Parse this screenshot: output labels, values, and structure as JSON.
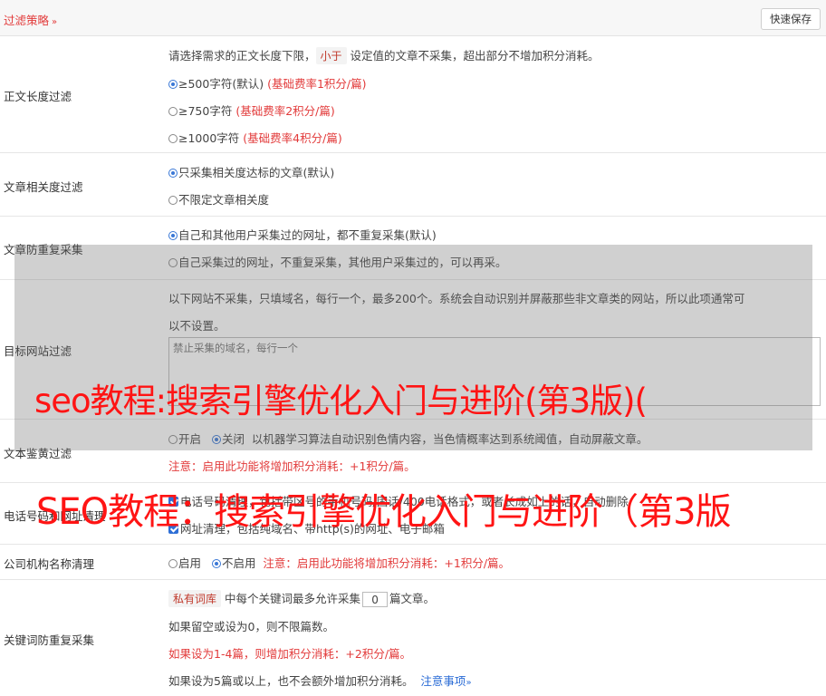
{
  "header": {
    "title": "过滤策略",
    "chevron": "»",
    "save_label": "快速保存"
  },
  "length_filter": {
    "label": "正文长度过滤",
    "desc_pre": "请选择需求的正文长度下限，",
    "desc_tag": "小于",
    "desc_post": "设定值的文章不采集，超出部分不增加积分消耗。",
    "options": [
      {
        "text": "≥500字符(默认)",
        "note": "(基础费率1积分/篇)"
      },
      {
        "text": "≥750字符",
        "note": "(基础费率2积分/篇)"
      },
      {
        "text": "≥1000字符",
        "note": "(基础费率4积分/篇)"
      }
    ]
  },
  "relevance": {
    "label": "文章相关度过滤",
    "options": [
      "只采集相关度达标的文章(默认)",
      "不限定文章相关度"
    ]
  },
  "dedupe": {
    "label": "文章防重复采集",
    "options": [
      "自己和其他用户采集过的网址，都不重复采集(默认)",
      "自己采集过的网址，不重复采集，其他用户采集过的，可以再采。"
    ]
  },
  "site_filter": {
    "label": "目标网站过滤",
    "desc_1": "以下网站不采集，只填域名，每行一个，最多200个。系统会自动识别并屏蔽那些非文章类的网站，所以此项通常可",
    "desc_2": "以不设置。",
    "placeholder": "禁止采集的域名，每行一个"
  },
  "porn": {
    "label": "文本鉴黄过滤",
    "on_label": "开启",
    "off_label": "关闭",
    "desc": "以机器学习算法自动识别色情内容，当色情概率达到系统阈值，自动屏蔽文章。",
    "note": "注意：启用此功能将增加积分消耗：+1积分/篇。"
  },
  "phone": {
    "label": "电话号码和网址清理",
    "option1": "电话号码清理，包括带区号的手机号码/固话/400电话格式，或者长成如上的话，自动删除",
    "option2": "网址清理，包括纯域名、带http(s)的网址、电子邮箱"
  },
  "org": {
    "label": "公司机构名称清理",
    "on_label": "启用",
    "off_label": "不启用",
    "note": "注意：启用此功能将增加积分消耗：+1积分/篇。"
  },
  "keyword": {
    "label": "关键词防重复采集",
    "tag": "私有词库",
    "line1_mid": "中每个关键词最多允许采集",
    "value": "0",
    "line1_post": "篇文章。",
    "line2": "如果留空或设为0，则不限篇数。",
    "line3": "如果设为1-4篇，则增加积分消耗：+2积分/篇。",
    "line4": "如果设为5篇或以上，也不会额外增加积分消耗。",
    "link": "注意事项",
    "link_chevron": "»"
  },
  "watermark": {
    "line1": "seo教程:搜索引擎优化入门与进阶(第3版)(",
    "line2": "SEO教程：搜索引擎优化入门与进阶（第3版"
  },
  "colors": {
    "accent_red": "#e23a3a",
    "radio_blue": "#3a78d6",
    "link_blue": "#2b6cd6",
    "watermark_red": "#ff1414"
  }
}
